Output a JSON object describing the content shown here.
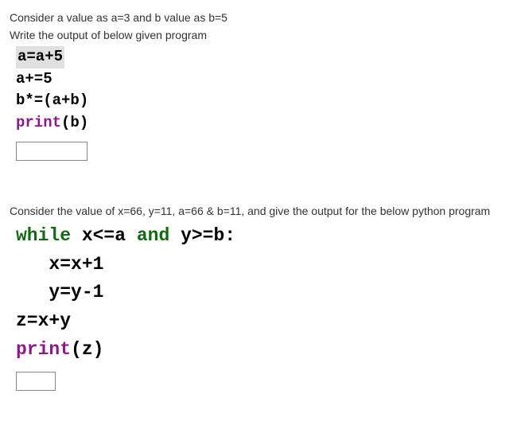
{
  "q1": {
    "prompt1": "Consider a value as a=3 and b value as b=5",
    "prompt2": "Write the output of below given program",
    "code": {
      "l1": "a=a+5",
      "l2": "a+=5",
      "l3": "b*=(a+b)",
      "l4_a": "print",
      "l4_b": "(b)"
    },
    "answer": ""
  },
  "q2": {
    "prompt1": "Consider the value of x=66, y=11, a=66 & b=11,  and give the output for the below python program",
    "code": {
      "l1_a": "while",
      "l1_b": " x<=a ",
      "l1_c": "and",
      "l1_d": " y>=b:",
      "l2": "   x=x+1",
      "l3": "   y=y-1",
      "l4": "z=x+y",
      "l5_a": "print",
      "l5_b": "(z)"
    },
    "answer": ""
  }
}
